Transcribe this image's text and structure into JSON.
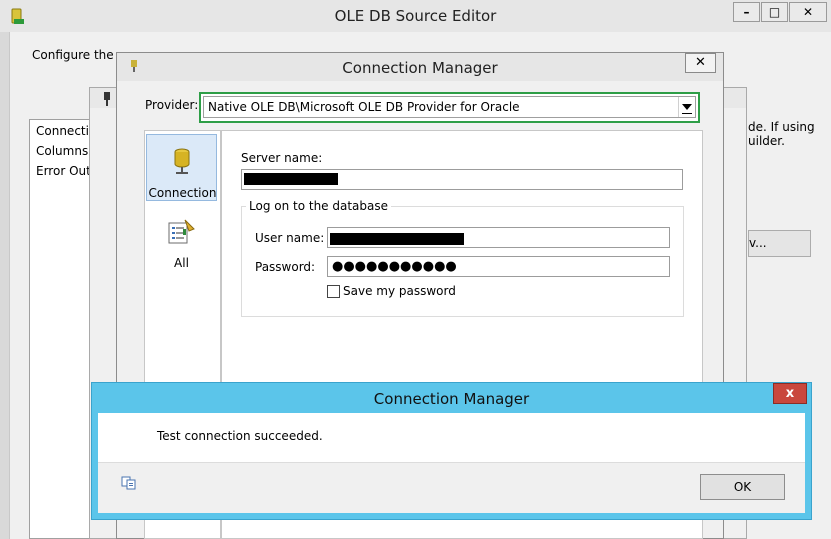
{
  "back_window": {
    "title": "OLE DB Source Editor",
    "description": "Configure the p",
    "description_right_1": "de. If using",
    "description_right_2": "uilder.",
    "nav_items": [
      "Connectio",
      "Columns",
      "Error Outp"
    ],
    "button_label": "v...",
    "minimize_label": "–",
    "restore_label": "□",
    "close_label": "✕"
  },
  "connection_manager": {
    "title": "Connection Manager",
    "close_label": "✕",
    "provider_label": "Provider:",
    "provider_value": "Native OLE DB\\Microsoft OLE DB Provider for Oracle",
    "sidebar": [
      {
        "label": "Connection",
        "icon": "database-icon",
        "selected": true
      },
      {
        "label": "All",
        "icon": "properties-icon",
        "selected": false
      }
    ],
    "server_name_label": "Server name:",
    "server_name_value": "",
    "logon_group_title": "Log on to the database",
    "user_name_label": "User name:",
    "user_name_value": "",
    "password_label": "Password:",
    "password_value": "●●●●●●●●●●●",
    "save_password_label": "Save my password",
    "save_password_checked": false
  },
  "message_dialog": {
    "title": "Connection Manager",
    "close_label": "x",
    "message": "Test connection succeeded.",
    "ok_label": "OK"
  },
  "colors": {
    "highlight_border": "#2e9e47",
    "dialog_frame": "#5bc5ea",
    "close_red": "#c9473d"
  }
}
